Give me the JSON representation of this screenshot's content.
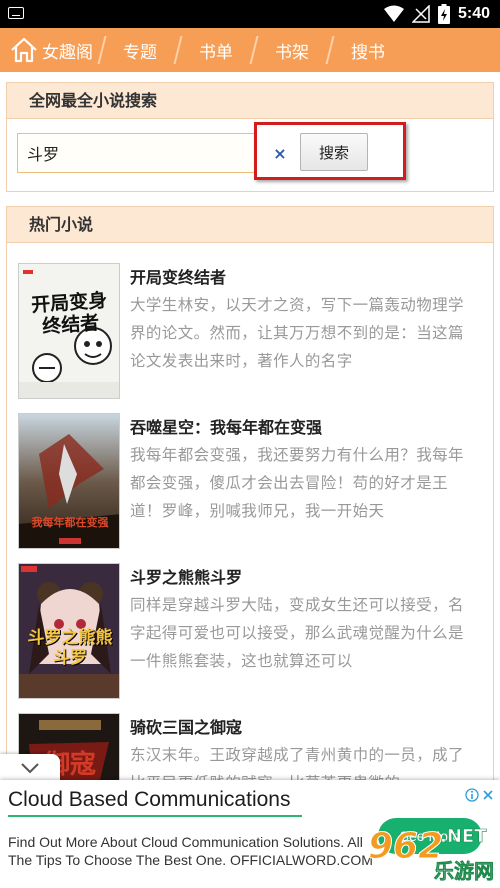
{
  "status_bar": {
    "time": "5:40"
  },
  "nav": {
    "brand": "女趣阁",
    "items": [
      "专题",
      "书单",
      "书架",
      "搜书"
    ]
  },
  "search": {
    "heading": "全网最全小说搜索",
    "query": "斗罗",
    "clear_symbol": "×",
    "button_label": "搜索"
  },
  "hot": {
    "heading": "热门小说",
    "books": [
      {
        "title": "开局变终结者",
        "desc": "大学生林安，以天才之资，写下一篇轰动物理学界的论文。然而，让其万万想不到的是：当这篇论文发表出来时，著作人的名字",
        "cover_text": "开局变身终结者"
      },
      {
        "title": "吞噬星空：我每年都在变强",
        "desc": "我每年都会变强，我还要努力有什么用？我每年都会变强，傻瓜才会出去冒险！苟的好才是王道！罗峰，别喊我师兄，我一开始天",
        "cover_text": "我每年都在变强"
      },
      {
        "title": "斗罗之熊熊斗罗",
        "desc": "同样是穿越斗罗大陆，变成女生还可以接受，名字起得可爱也可以接受，那么武魂觉醒为什么是一件熊熊套装，这也就算还可以",
        "cover_text": "斗罗之熊熊斗罗"
      },
      {
        "title": "骑砍三国之御寇",
        "desc": "东汉末年。王政穿越成了青州黄巾的一员，成了比平民更低贱的贼寇，比草芥更卑微的",
        "cover_text": "御寇"
      }
    ]
  },
  "ad": {
    "title": "Cloud Based Communications",
    "line1": "Find Out More About Cloud Communication Solutions. All",
    "line2": "The Tips To Choose The Best One. OFFICIALWORD.COM",
    "button": "See More"
  },
  "watermark": {
    "number": "962",
    "suffix": ".NET",
    "text": "乐游网"
  },
  "colors": {
    "nav": "#f79e56",
    "panel_head": "#fde8d4",
    "highlight": "#d21d1d",
    "ad_button": "#17b06e"
  }
}
